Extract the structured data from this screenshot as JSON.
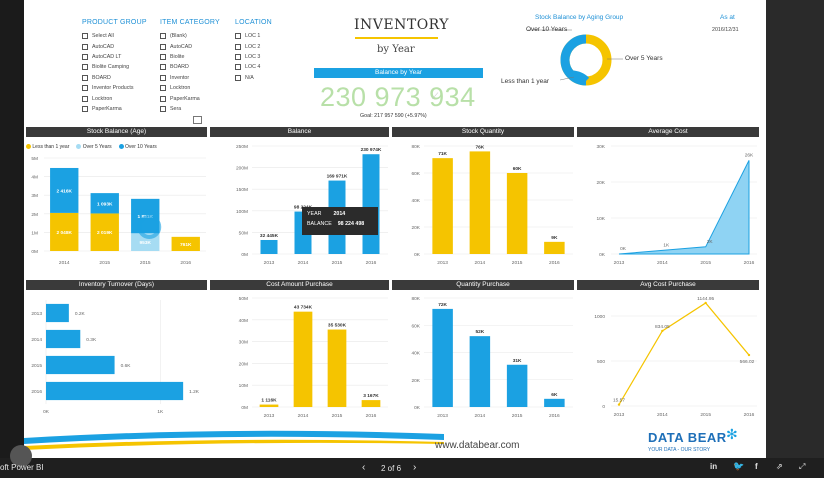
{
  "app": {
    "name": "oft Power BI",
    "page": "2 of 6"
  },
  "slicers": {
    "product_group": {
      "title": "PRODUCT GROUP",
      "items": [
        "Select All",
        "AutoCAD",
        "AutoCAD LT",
        "Biolite Camping",
        "BOARD",
        "Inventor Products",
        "Locktron",
        "PaperKarma"
      ]
    },
    "item_category": {
      "title": "ITEM CATEGORY",
      "items": [
        "(Blank)",
        "AutoCAD",
        "Biolite",
        "BOARD",
        "Inventor",
        "Locktron",
        "PaperKarma",
        "Sera"
      ]
    },
    "location": {
      "title": "LOCATION",
      "items": [
        "LOC 1",
        "LOC 2",
        "LOC 3",
        "LOC 4",
        "N/A"
      ]
    }
  },
  "header": {
    "title": "INVENTORY",
    "subtitle": "by Year",
    "kpi_label": "Balance by Year",
    "kpi_value": "230 973 934",
    "kpi_goal": "Goal: 217 957 590 (+5.97%)",
    "as_at_label": "As at",
    "as_at_date": "2016/12/31"
  },
  "donut": {
    "title": "Stock Balance by Aging Group",
    "labels": [
      "Over 10 Years",
      "Over 5 Years",
      "Less than 1 year"
    ],
    "colors": [
      "#1ba1e2",
      "#f5c400",
      "#1ba1e2"
    ]
  },
  "colors": {
    "blue": "#1ba1e2",
    "yellow": "#f5c400",
    "light_blue": "#a6dcf3",
    "dark": "#3a3a3a"
  },
  "panels": {
    "stock_balance_age": {
      "title": "Stock Balance (Age)",
      "legend": [
        "Less than 1 year",
        "Over 5 Years",
        "Over 10 Years"
      ],
      "y_ticks": [
        "5M",
        "4M",
        "3M",
        "2M",
        "1M",
        "0M"
      ],
      "x": [
        "2014",
        "2015",
        "2015",
        "2016"
      ],
      "labels": [
        "2 416K",
        "2 048K",
        "1 093K",
        "2 019K",
        "1 851K",
        "953K",
        "761K"
      ]
    },
    "balance": {
      "title": "Balance",
      "y_ticks": [
        "250M",
        "200M",
        "150M",
        "100M",
        "50M",
        "0M"
      ],
      "x": [
        "2013",
        "2014",
        "2015",
        "2016"
      ],
      "values_label": [
        "32 445K",
        "98 224K",
        "169 971K",
        "230 974K"
      ],
      "tooltip": {
        "k1": "YEAR",
        "v1": "2014",
        "k2": "BALANCE",
        "v2": "98 224 498"
      }
    },
    "stock_quantity": {
      "title": "Stock Quantity",
      "y_ticks": [
        "80K",
        "60K",
        "40K",
        "20K",
        "0K"
      ],
      "x": [
        "2013",
        "2014",
        "2015",
        "2016"
      ],
      "values_label": [
        "71K",
        "76K",
        "60K",
        "9K"
      ]
    },
    "average_cost": {
      "title": "Average Cost",
      "y_ticks": [
        "30K",
        "20K",
        "10K",
        "0K"
      ],
      "x": [
        "2013",
        "2014",
        "2015",
        "2016"
      ],
      "values_label": [
        "0K",
        "1K",
        "2K",
        "26K"
      ]
    },
    "inventory_turnover": {
      "title": "Inventory Turnover (Days)",
      "y": [
        "2013",
        "2014",
        "2015",
        "2016"
      ],
      "values_label": [
        "0.2K",
        "0.3K",
        "0.6K",
        "1.2K"
      ],
      "x_ticks": [
        "0K",
        "1K"
      ]
    },
    "cost_amount_purchase": {
      "title": "Cost Amount Purchase",
      "y_ticks": [
        "50M",
        "40M",
        "30M",
        "20M",
        "10M",
        "0M"
      ],
      "x": [
        "2013",
        "2014",
        "2015",
        "2016"
      ],
      "values_label": [
        "1 116K",
        "43 734K",
        "35 530K",
        "3 167K"
      ]
    },
    "quantity_purchase": {
      "title": "Quantity Purchase",
      "y_ticks": [
        "80K",
        "60K",
        "40K",
        "20K",
        "0K"
      ],
      "x": [
        "2013",
        "2014",
        "2015",
        "2016"
      ],
      "values_label": [
        "72K",
        "52K",
        "31K",
        "6K"
      ]
    },
    "avg_cost_purchase": {
      "title": "Avg Cost Purchase",
      "y_ticks": [
        "1000",
        "500",
        "0"
      ],
      "x": [
        "2013",
        "2014",
        "2015",
        "2016"
      ],
      "values_label": [
        "15.57",
        "834.05",
        "1144.95",
        "566.02"
      ]
    }
  },
  "footer_brand": {
    "url": "www.databear.com",
    "logo": "DATA BEAR",
    "tagline": "YOUR DATA - OUR STORY"
  },
  "chart_data": [
    {
      "type": "bar",
      "title": "Stock Balance (Age)",
      "categories": [
        "2014",
        "2015",
        "2015",
        "2016"
      ],
      "series": [
        {
          "name": "Less than 1 year",
          "values": [
            2048,
            2019,
            953,
            761
          ]
        },
        {
          "name": "Over 10 Years",
          "values": [
            2416,
            1093,
            1851,
            0
          ]
        }
      ],
      "ylim": [
        0,
        5000
      ]
    },
    {
      "type": "bar",
      "title": "Balance",
      "categories": [
        "2013",
        "2014",
        "2015",
        "2016"
      ],
      "values": [
        32445,
        98224,
        169971,
        230974
      ],
      "ylim": [
        0,
        250000
      ]
    },
    {
      "type": "bar",
      "title": "Stock Quantity",
      "categories": [
        "2013",
        "2014",
        "2015",
        "2016"
      ],
      "values": [
        71,
        76,
        60,
        9
      ],
      "ylim": [
        0,
        80
      ]
    },
    {
      "type": "area",
      "title": "Average Cost",
      "categories": [
        "2013",
        "2014",
        "2015",
        "2016"
      ],
      "values": [
        0,
        1,
        2,
        26
      ],
      "ylim": [
        0,
        30
      ]
    },
    {
      "type": "bar",
      "title": "Inventory Turnover (Days)",
      "categories": [
        "2013",
        "2014",
        "2015",
        "2016"
      ],
      "values": [
        0.2,
        0.3,
        0.6,
        1.2
      ]
    },
    {
      "type": "bar",
      "title": "Cost Amount Purchase",
      "categories": [
        "2013",
        "2014",
        "2015",
        "2016"
      ],
      "values": [
        1116,
        43734,
        35530,
        3167
      ],
      "ylim": [
        0,
        50000
      ]
    },
    {
      "type": "bar",
      "title": "Quantity Purchase",
      "categories": [
        "2013",
        "2014",
        "2015",
        "2016"
      ],
      "values": [
        72,
        52,
        31,
        6
      ],
      "ylim": [
        0,
        80
      ]
    },
    {
      "type": "line",
      "title": "Avg Cost Purchase",
      "categories": [
        "2013",
        "2014",
        "2015",
        "2016"
      ],
      "values": [
        15.57,
        834.05,
        1144.95,
        566.02
      ],
      "ylim": [
        0,
        1200
      ]
    }
  ]
}
